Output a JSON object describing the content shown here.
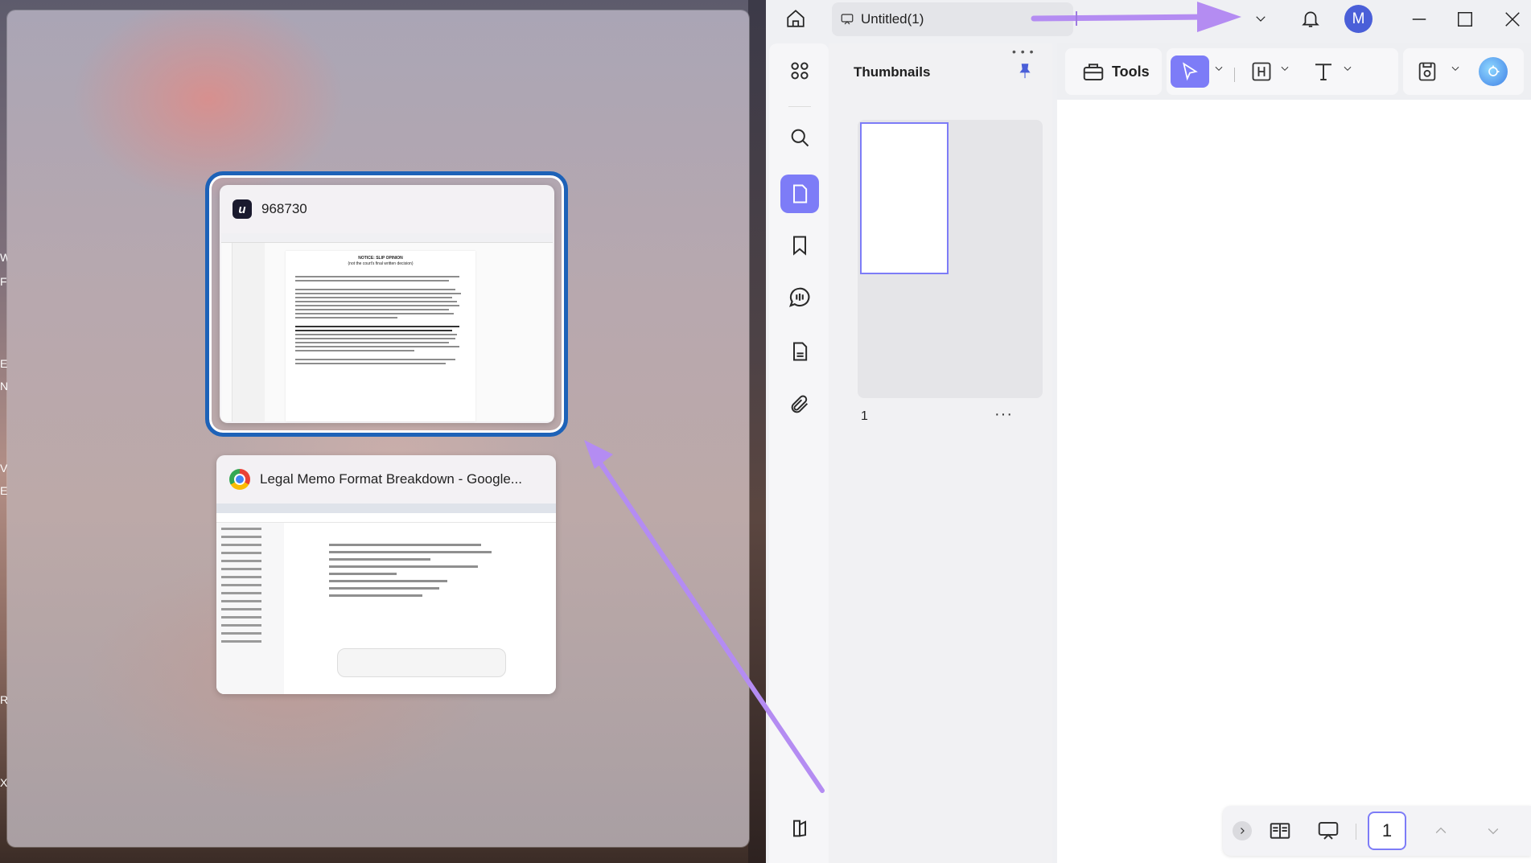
{
  "desktop": {
    "edge_letters": [
      "W",
      "F",
      "E",
      "N",
      "V",
      "E",
      "R",
      "X"
    ]
  },
  "snap_assist": {
    "windows": [
      {
        "title": "968730",
        "app_icon": "updf-icon",
        "preview": {
          "heading_line1": "NOTICE: SLIP OPINION",
          "heading_line2": "(not the court's final written decision)"
        }
      },
      {
        "title": "Legal Memo Format Breakdown - Google...",
        "app_icon": "chrome-icon"
      }
    ]
  },
  "app": {
    "tab_title": "Untitled(1)",
    "avatar_initial": "M",
    "thumbnails": {
      "title": "Thumbnails",
      "page_number": "1",
      "more": "···"
    },
    "toolbar": {
      "tools_label": "Tools"
    },
    "bottom_bar": {
      "current_page": "1"
    },
    "colors": {
      "accent": "#7d7cf7",
      "snap_focus_border": "#1d62b8",
      "annotation_arrow": "#b48cf2"
    }
  }
}
